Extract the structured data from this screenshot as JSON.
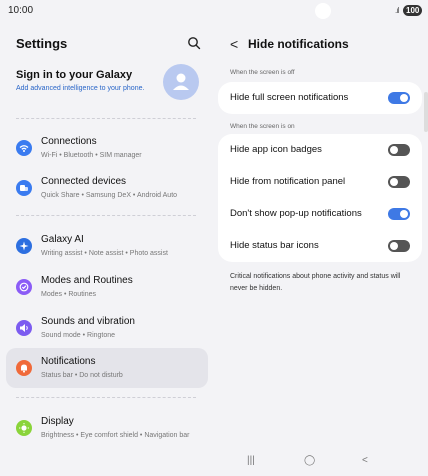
{
  "status_bar": {
    "time": "10:00",
    "battery": "100",
    "signal": ".ıl"
  },
  "left_pane": {
    "title": "Settings",
    "account": {
      "name": "Sign in to your Galaxy",
      "subtitle": "Add advanced intelligence to your phone."
    },
    "items": [
      {
        "label": "Connections",
        "subtitle": "Wi-Fi  •  Bluetooth  •  SIM manager",
        "icon": "wifi-icon",
        "color": "#3a7bf0"
      },
      {
        "label": "Connected devices",
        "subtitle": "Quick Share  •  Samsung DeX  •  Android Auto",
        "icon": "devices-icon",
        "color": "#3a7bf0"
      },
      {
        "label": "Galaxy AI",
        "subtitle": "Writing assist  •  Note assist  •  Photo assist",
        "icon": "sparkle-icon",
        "color": "#2d6fe0"
      },
      {
        "label": "Modes and Routines",
        "subtitle": "Modes  •  Routines",
        "icon": "check-circle-icon",
        "color": "#8b5cf6"
      },
      {
        "label": "Sounds and vibration",
        "subtitle": "Sound mode  •  Ringtone",
        "icon": "speaker-icon",
        "color": "#7c5cf0"
      },
      {
        "label": "Notifications",
        "subtitle": "Status bar  •  Do not disturb",
        "icon": "bell-icon",
        "color": "#f06a3a"
      },
      {
        "label": "Display",
        "subtitle": "Brightness  •  Eye comfort shield  •  Navigation bar",
        "icon": "sun-icon",
        "color": "#8ad43a"
      }
    ]
  },
  "right_pane": {
    "title": "Hide notifications",
    "section_off": "When the screen is off",
    "section_on": "When the screen is on",
    "off_rows": [
      {
        "label": "Hide full screen notifications",
        "on": true
      }
    ],
    "on_rows": [
      {
        "label": "Hide app icon badges",
        "on": false
      },
      {
        "label": "Hide from notification panel",
        "on": false
      },
      {
        "label": "Don't show pop-up notifications",
        "on": true
      },
      {
        "label": "Hide status bar icons",
        "on": false
      }
    ],
    "note": "Critical notifications about phone activity and status will never be hidden."
  },
  "nav_bar": {
    "recents": "|||",
    "home": "◯",
    "back": "<"
  }
}
